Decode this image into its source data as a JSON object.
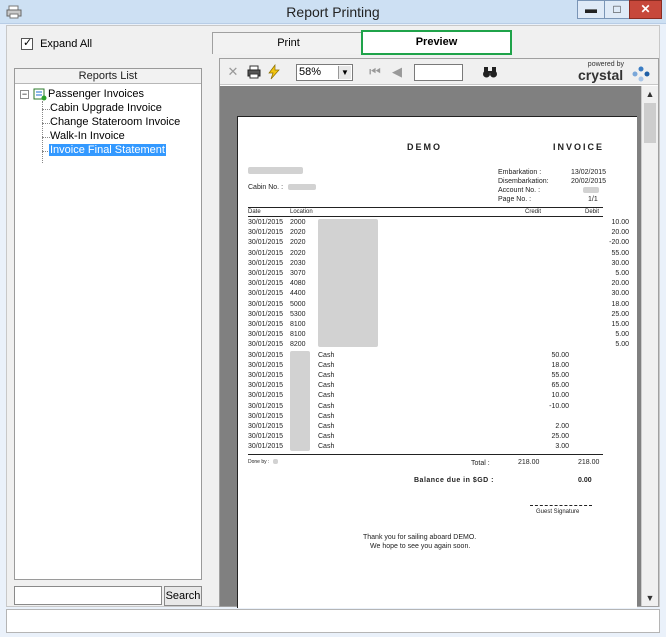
{
  "window": {
    "title": "Report Printing"
  },
  "left_panel": {
    "expand_all_label": "Expand All",
    "reports_list_header": "Reports List",
    "tree_root": "Passenger Invoices",
    "tree_items": [
      "Cabin Upgrade Invoice",
      "Change Stateroom Invoice",
      "Walk-In Invoice",
      "Invoice Final Statement"
    ],
    "selected_item": "Invoice Final Statement",
    "search_button": "Search"
  },
  "tabs": {
    "print": "Print",
    "preview": "Preview"
  },
  "toolbar": {
    "zoom": "58%",
    "brand_small": "powered by",
    "brand": "crystal"
  },
  "invoice": {
    "company": "DEMO",
    "doc_title": "INVOICE",
    "embarkation_label": "Embarkation :",
    "embarkation_date": "13/02/2015",
    "disembarkation_label": "Disembarkation:",
    "disembarkation_date": "20/02/2015",
    "account_label": "Account No. :",
    "page_label": "Page No. :",
    "page_value": "1/1",
    "cabin_label": "Cabin No. :",
    "col_date": "Date",
    "col_location": "Location",
    "col_credit": "Credit",
    "col_debit": "Debit",
    "rows": [
      {
        "date": "30/01/2015",
        "loc": "2000",
        "desc": "",
        "credit": "",
        "debit": "10.00"
      },
      {
        "date": "30/01/2015",
        "loc": "2020",
        "desc": "",
        "credit": "",
        "debit": "20.00"
      },
      {
        "date": "30/01/2015",
        "loc": "2020",
        "desc": "",
        "credit": "",
        "debit": "-20.00"
      },
      {
        "date": "30/01/2015",
        "loc": "2020",
        "desc": "",
        "credit": "",
        "debit": "55.00"
      },
      {
        "date": "30/01/2015",
        "loc": "2030",
        "desc": "",
        "credit": "",
        "debit": "30.00"
      },
      {
        "date": "30/01/2015",
        "loc": "3070",
        "desc": "",
        "credit": "",
        "debit": "5.00"
      },
      {
        "date": "30/01/2015",
        "loc": "4080",
        "desc": "",
        "credit": "",
        "debit": "20.00"
      },
      {
        "date": "30/01/2015",
        "loc": "4400",
        "desc": "",
        "credit": "",
        "debit": "30.00"
      },
      {
        "date": "30/01/2015",
        "loc": "5000",
        "desc": "",
        "credit": "",
        "debit": "18.00"
      },
      {
        "date": "30/01/2015",
        "loc": "5300",
        "desc": "",
        "credit": "",
        "debit": "25.00"
      },
      {
        "date": "30/01/2015",
        "loc": "8100",
        "desc": "",
        "credit": "",
        "debit": "15.00"
      },
      {
        "date": "30/01/2015",
        "loc": "8100",
        "desc": "",
        "credit": "",
        "debit": "5.00"
      },
      {
        "date": "30/01/2015",
        "loc": "8200",
        "desc": "",
        "credit": "",
        "debit": "5.00"
      },
      {
        "date": "30/01/2015",
        "loc": "",
        "desc": "Cash",
        "credit": "50.00",
        "debit": ""
      },
      {
        "date": "30/01/2015",
        "loc": "",
        "desc": "Cash",
        "credit": "18.00",
        "debit": ""
      },
      {
        "date": "30/01/2015",
        "loc": "",
        "desc": "Cash",
        "credit": "55.00",
        "debit": ""
      },
      {
        "date": "30/01/2015",
        "loc": "",
        "desc": "Cash",
        "credit": "65.00",
        "debit": ""
      },
      {
        "date": "30/01/2015",
        "loc": "",
        "desc": "Cash",
        "credit": "10.00",
        "debit": ""
      },
      {
        "date": "30/01/2015",
        "loc": "",
        "desc": "Cash",
        "credit": "-10.00",
        "debit": ""
      },
      {
        "date": "30/01/2015",
        "loc": "",
        "desc": "Cash",
        "credit": "",
        "debit": ""
      },
      {
        "date": "30/01/2015",
        "loc": "",
        "desc": "Cash",
        "credit": "2.00",
        "debit": ""
      },
      {
        "date": "30/01/2015",
        "loc": "",
        "desc": "Cash",
        "credit": "25.00",
        "debit": ""
      },
      {
        "date": "30/01/2015",
        "loc": "",
        "desc": "Cash",
        "credit": "3.00",
        "debit": ""
      }
    ],
    "done_by_label": "Done by :",
    "total_label": "Total :",
    "total_credit": "218.00",
    "total_debit": "218.00",
    "balance_label": "Balance due in $GD :",
    "balance_value": "0.00",
    "signature_label": "Guest Signature",
    "thanks_line1": "Thank you for sailing aboard DEMO.",
    "thanks_line2": "We hope to see you again soon."
  }
}
